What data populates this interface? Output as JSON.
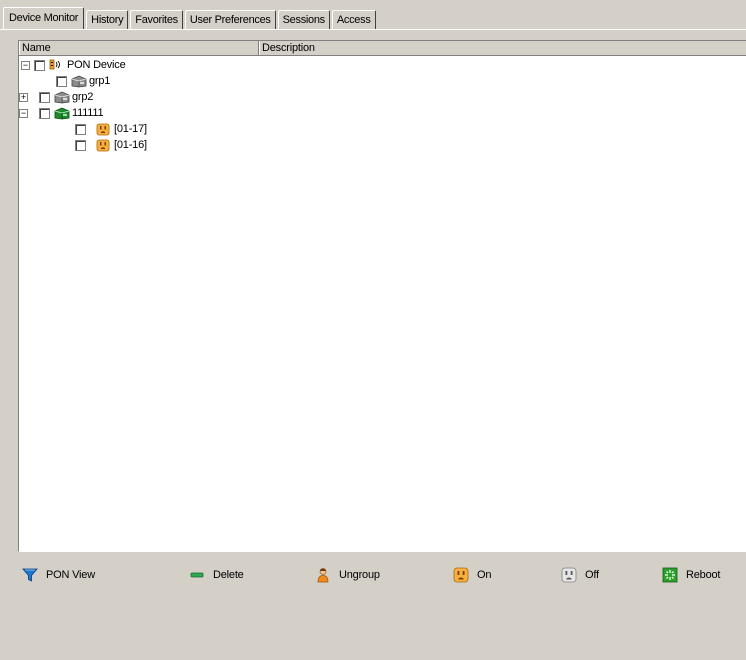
{
  "tabs": [
    {
      "label": "Device Monitor",
      "active": true
    },
    {
      "label": "History",
      "active": false
    },
    {
      "label": "Favorites",
      "active": false
    },
    {
      "label": "User Preferences",
      "active": false
    },
    {
      "label": "Sessions",
      "active": false
    },
    {
      "label": "Access",
      "active": false
    }
  ],
  "tree": {
    "columns": {
      "name": "Name",
      "description": "Description"
    },
    "nodes": [
      {
        "label": "PON Device",
        "icon": "pon-device-icon",
        "expander": "collapse"
      },
      {
        "label": "grp1",
        "icon": "gray-group-icon",
        "expander": "none"
      },
      {
        "label": "grp2",
        "icon": "gray-group-icon",
        "expander": "expand"
      },
      {
        "label": "111111",
        "icon": "green-group-icon",
        "expander": "collapse"
      },
      {
        "label": "[01-17]",
        "icon": "outlet-on-icon",
        "expander": "none"
      },
      {
        "label": "[01-16]",
        "icon": "outlet-on-icon",
        "expander": "none"
      }
    ]
  },
  "toolbar": {
    "pon_view": "PON View",
    "delete": "Delete",
    "ungroup": "Ungroup",
    "on": "On",
    "off": "Off",
    "reboot": "Reboot"
  },
  "colors": {
    "filter_blue": "#1a78d0",
    "delete_green": "#2fa84f",
    "outlet_orange": "#f0a020",
    "reboot_green": "#2ca02c"
  }
}
